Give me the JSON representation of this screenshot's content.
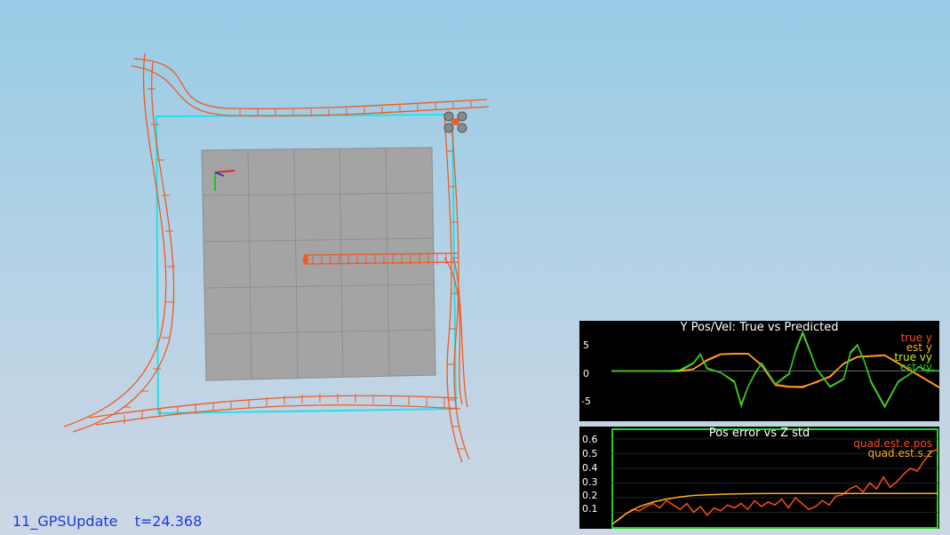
{
  "status": {
    "scenario": "11_GPSUpdate",
    "time": "t=24.368"
  },
  "colors": {
    "trajectory": "#f05a24",
    "path": "#22e0e8",
    "grid": "#9a9a9a"
  },
  "chart_data": [
    {
      "type": "line",
      "title": "Y Pos/Vel: True vs Predicted",
      "ylim": [
        -9,
        9
      ],
      "yticks": [
        "5",
        "0",
        "-5"
      ],
      "series": [
        {
          "name": "true y",
          "color": "#ff4d1a",
          "x": [
            0,
            2,
            4,
            5,
            6,
            7,
            8,
            9,
            10,
            11,
            12,
            13,
            14,
            15,
            16,
            17,
            18,
            20,
            24
          ],
          "values": [
            0,
            0,
            0,
            0,
            0.3,
            2.2,
            3.3,
            3.4,
            3.4,
            1.0,
            -2.8,
            -3.1,
            -3.2,
            -2.0,
            -1.2,
            1.5,
            2.8,
            3.1,
            -3.1
          ]
        },
        {
          "name": "est y",
          "color": "#ffb020",
          "x": [
            0,
            2,
            4,
            5,
            6,
            7,
            8,
            9,
            10,
            11,
            12,
            13,
            14,
            15,
            16,
            17,
            18,
            20,
            24
          ],
          "values": [
            0,
            0,
            0,
            0,
            0.4,
            2.0,
            3.2,
            3.3,
            3.3,
            1.2,
            -2.6,
            -3.0,
            -3.0,
            -2.2,
            -1.0,
            1.4,
            2.7,
            3.0,
            -3.2
          ]
        },
        {
          "name": "true vy",
          "color": "#c8f000",
          "x": [
            0,
            4,
            5,
            6,
            6.5,
            7,
            8,
            9,
            9.5,
            10,
            10.5,
            11,
            12,
            13,
            13.5,
            14,
            14.5,
            15,
            16,
            17,
            17.5,
            18,
            18.5,
            19,
            20,
            21,
            22,
            22.5,
            23,
            24
          ],
          "values": [
            0,
            0,
            0,
            1.5,
            3.2,
            0.5,
            -0.3,
            -2,
            -6.5,
            -3,
            -0.5,
            1.5,
            -2.5,
            -0.5,
            4,
            7.3,
            4,
            0.5,
            -3,
            -1.5,
            3.5,
            5,
            2,
            -2,
            -6.8,
            -2,
            -0.3,
            0.8,
            0.2,
            0
          ]
        },
        {
          "name": "est vy",
          "color": "#22c52a",
          "x": [
            0,
            4,
            5,
            6,
            6.5,
            7,
            8,
            9,
            9.5,
            10,
            10.5,
            11,
            12,
            13,
            13.5,
            14,
            14.5,
            15,
            16,
            17,
            17.5,
            18,
            18.5,
            19,
            20,
            21,
            22,
            22.5,
            23,
            24
          ],
          "values": [
            0,
            0,
            0.2,
            1.6,
            3.3,
            0.6,
            -0.3,
            -2.2,
            -6.8,
            -3,
            -0.6,
            1.5,
            -2.6,
            -0.6,
            4.2,
            7.6,
            4.2,
            0.5,
            -3.1,
            -1.6,
            3.7,
            5.1,
            2,
            -2.2,
            -7,
            -2.1,
            -0.3,
            0.8,
            0.2,
            0
          ]
        }
      ]
    },
    {
      "type": "line",
      "title": "Pos error vs Z std",
      "ylim": [
        0,
        0.66
      ],
      "yticks": [
        "0.6",
        "0.5",
        "0.4",
        "0.3",
        "0.2",
        "0.1"
      ],
      "series": [
        {
          "name": "quad.est.e.pos",
          "color": "#ff4d1a",
          "x": [
            0,
            0.5,
            1,
            1.5,
            2,
            2.5,
            3,
            3.5,
            4,
            4.5,
            5,
            5.5,
            6,
            6.5,
            7,
            7.5,
            8,
            8.5,
            9,
            9.5,
            10,
            10.5,
            11,
            11.5,
            12,
            12.5,
            13,
            13.5,
            14,
            14.5,
            15,
            15.5,
            16,
            16.5,
            17,
            17.5,
            18,
            18.5,
            19,
            19.5,
            20,
            20.5,
            21,
            21.5,
            22,
            22.5,
            23,
            23.5,
            24
          ],
          "values": [
            0.02,
            0.05,
            0.09,
            0.12,
            0.11,
            0.14,
            0.16,
            0.13,
            0.18,
            0.15,
            0.12,
            0.16,
            0.1,
            0.14,
            0.08,
            0.13,
            0.11,
            0.15,
            0.13,
            0.16,
            0.12,
            0.18,
            0.14,
            0.17,
            0.15,
            0.19,
            0.13,
            0.2,
            0.16,
            0.12,
            0.14,
            0.18,
            0.15,
            0.21,
            0.22,
            0.26,
            0.28,
            0.24,
            0.3,
            0.26,
            0.34,
            0.27,
            0.31,
            0.36,
            0.4,
            0.38,
            0.45,
            0.51,
            0.53
          ]
        },
        {
          "name": "quad.est.s.z",
          "color": "#ffb020",
          "x": [
            0,
            1,
            2,
            3,
            4,
            5,
            6,
            7,
            8,
            9,
            10,
            12,
            14,
            16,
            18,
            20,
            22,
            24
          ],
          "values": [
            0.02,
            0.09,
            0.14,
            0.17,
            0.19,
            0.205,
            0.215,
            0.22,
            0.223,
            0.225,
            0.227,
            0.228,
            0.229,
            0.229,
            0.229,
            0.229,
            0.229,
            0.229
          ]
        }
      ]
    }
  ]
}
